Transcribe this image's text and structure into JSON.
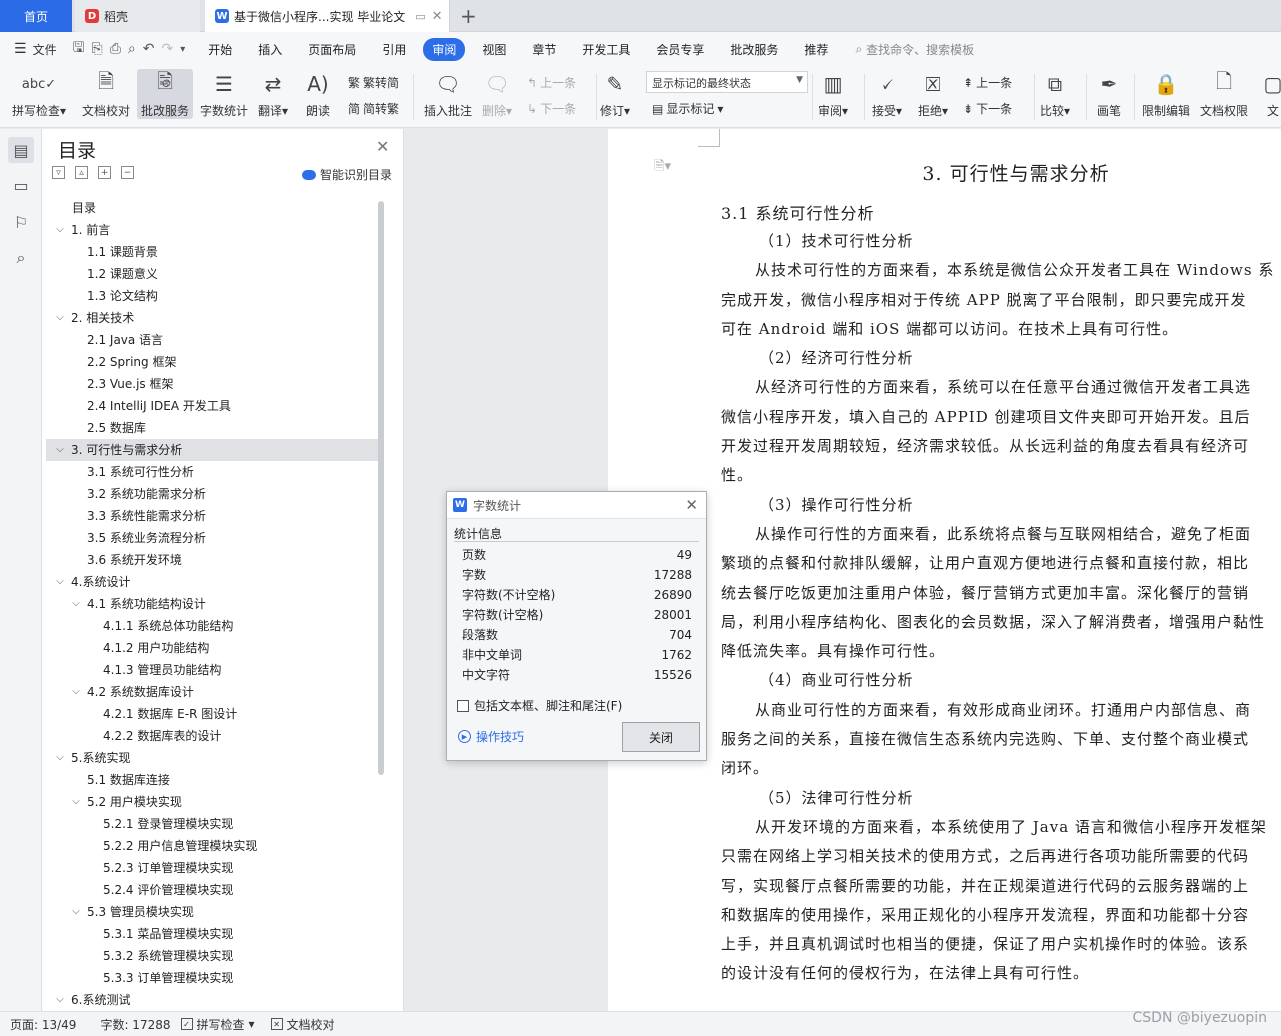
{
  "tabs": {
    "home": "首页",
    "shell": "稻壳",
    "doc": "基于微信小程序...实现 毕业论文"
  },
  "menubar": {
    "file": "文件",
    "items": [
      "开始",
      "插入",
      "页面布局",
      "引用",
      "审阅",
      "视图",
      "章节",
      "开发工具",
      "会员专享",
      "批改服务",
      "推荐"
    ],
    "active": "审阅",
    "search_placeholder": "查找命令、搜索模板"
  },
  "ribbon": {
    "spellcheck": "拼写检查",
    "proofread": "文档校对",
    "correction_service": "批改服务",
    "word_count": "字数统计",
    "translate": "翻译",
    "read_aloud": "朗读",
    "trad": "繁转简",
    "simp": "简转繁",
    "insert_comment": "插入批注",
    "delete": "删除",
    "prev": "上一条",
    "next": "下一条",
    "track": "修订",
    "display_state": "显示标记的最终状态",
    "show_markup": "显示标记",
    "review": "审阅",
    "accept": "接受",
    "reject": "拒绝",
    "prev2": "上一条",
    "next2": "下一条",
    "compare": "比较",
    "pen": "画笔",
    "restrict": "限制编辑",
    "doc_rights": "文档权限",
    "more": "文"
  },
  "toc": {
    "title": "目录",
    "smart": "智能识别目录",
    "items": [
      {
        "text": "目录",
        "level": 0,
        "chev": false
      },
      {
        "text": "1.  前言",
        "level": 0,
        "chev": true
      },
      {
        "text": "1.1  课题背景",
        "level": 1,
        "chev": false
      },
      {
        "text": "1.2  课题意义",
        "level": 1,
        "chev": false
      },
      {
        "text": "1.3  论文结构",
        "level": 1,
        "chev": false
      },
      {
        "text": "2.  相关技术",
        "level": 0,
        "chev": true
      },
      {
        "text": "2.1 Java 语言",
        "level": 1,
        "chev": false
      },
      {
        "text": "2.2 Spring 框架",
        "level": 1,
        "chev": false
      },
      {
        "text": "2.3 Vue.js 框架",
        "level": 1,
        "chev": false
      },
      {
        "text": "2.4 IntelliJ IDEA 开发工具",
        "level": 1,
        "chev": false
      },
      {
        "text": "2.5  数据库",
        "level": 1,
        "chev": false
      },
      {
        "text": "3.  可行性与需求分析",
        "level": 0,
        "chev": true,
        "active": true
      },
      {
        "text": "3.1  系统可行性分析",
        "level": 1,
        "chev": false
      },
      {
        "text": "3.2  系统功能需求分析",
        "level": 1,
        "chev": false
      },
      {
        "text": "3.3  系统性能需求分析",
        "level": 1,
        "chev": false
      },
      {
        "text": "3.5  系统业务流程分析",
        "level": 1,
        "chev": false
      },
      {
        "text": "3.6  系统开发环境",
        "level": 1,
        "chev": false
      },
      {
        "text": "4.系统设计",
        "level": 0,
        "chev": true
      },
      {
        "text": "4.1 系统功能结构设计",
        "level": 1,
        "chev": true
      },
      {
        "text": "4.1.1  系统总体功能结构",
        "level": 2,
        "chev": false
      },
      {
        "text": "4.1.2  用户功能结构",
        "level": 2,
        "chev": false
      },
      {
        "text": "4.1.3  管理员功能结构",
        "level": 2,
        "chev": false
      },
      {
        "text": "4.2  系统数据库设计",
        "level": 1,
        "chev": true
      },
      {
        "text": "4.2.1  数据库 E-R 图设计",
        "level": 2,
        "chev": false
      },
      {
        "text": "4.2.2  数据库表的设计",
        "level": 2,
        "chev": false
      },
      {
        "text": "5.系统实现",
        "level": 0,
        "chev": true
      },
      {
        "text": "5.1 数据库连接",
        "level": 1,
        "chev": false
      },
      {
        "text": "5.2 用户模块实现",
        "level": 1,
        "chev": true
      },
      {
        "text": "5.2.1  登录管理模块实现",
        "level": 2,
        "chev": false
      },
      {
        "text": "5.2.2  用户信息管理模块实现",
        "level": 2,
        "chev": false
      },
      {
        "text": "5.2.3  订单管理模块实现",
        "level": 2,
        "chev": false
      },
      {
        "text": "5.2.4  评价管理模块实现",
        "level": 2,
        "chev": false
      },
      {
        "text": "5.3  管理员模块实现",
        "level": 1,
        "chev": true
      },
      {
        "text": "5.3.1  菜品管理模块实现",
        "level": 2,
        "chev": false
      },
      {
        "text": "5.3.2  系统管理模块实现",
        "level": 2,
        "chev": false
      },
      {
        "text": "5.3.3  订单管理模块实现",
        "level": 2,
        "chev": false
      },
      {
        "text": "6.系统测试",
        "level": 0,
        "chev": true
      }
    ]
  },
  "page": {
    "chapter": "3. 可行性与需求分析",
    "section": "3.1  系统可行性分析",
    "lines": [
      {
        "t": "（1）技术可行性分析",
        "k": "sub"
      },
      {
        "t": "从技术可行性的方面来看，本系统是微信公众开发者工具在 Windows 系",
        "k": "ind"
      },
      {
        "t": "完成开发，微信小程序相对于传统 APP 脱离了平台限制，即只要完成开发",
        "k": ""
      },
      {
        "t": "可在 Android 端和 iOS 端都可以访问。在技术上具有可行性。",
        "k": ""
      },
      {
        "t": "（2）经济可行性分析",
        "k": "sub"
      },
      {
        "t": "从经济可行性的方面来看，系统可以在任意平台通过微信开发者工具选",
        "k": "ind"
      },
      {
        "t": "微信小程序开发，填入自己的 APPID 创建项目文件夹即可开始开发。且后",
        "k": ""
      },
      {
        "t": "开发过程开发周期较短，经济需求较低。从长远利益的角度去看具有经济可",
        "k": ""
      },
      {
        "t": "性。",
        "k": ""
      },
      {
        "t": "（3）操作可行性分析",
        "k": "sub"
      },
      {
        "t": "从操作可行性的方面来看，此系统将点餐与互联网相结合，避免了柜面",
        "k": "ind"
      },
      {
        "t": "繁琐的点餐和付款排队缓解，让用户直观方便地进行点餐和直接付款，相比",
        "k": ""
      },
      {
        "t": "统去餐厅吃饭更加注重用户体验，餐厅营销方式更加丰富。深化餐厅的营销",
        "k": ""
      },
      {
        "t": "局，利用小程序结构化、图表化的会员数据，深入了解消费者，增强用户黏性",
        "k": ""
      },
      {
        "t": "降低流失率。具有操作可行性。",
        "k": ""
      },
      {
        "t": "（4）商业可行性分析",
        "k": "sub"
      },
      {
        "t": "从商业可行性的方面来看，有效形成商业闭环。打通用户内部信息、商",
        "k": "ind"
      },
      {
        "t": "服务之间的关系，直接在微信生态系统内完选购、下单、支付整个商业模式",
        "k": ""
      },
      {
        "t": "闭环。",
        "k": ""
      },
      {
        "t": "（5）法律可行性分析",
        "k": "sub"
      },
      {
        "t": "从开发环境的方面来看，本系统使用了 Java 语言和微信小程序开发框架",
        "k": "ind"
      },
      {
        "t": "只需在网络上学习相关技术的使用方式，之后再进行各项功能所需要的代码",
        "k": ""
      },
      {
        "t": "写，实现餐厅点餐所需要的功能，并在正规渠道进行代码的云服务器端的上",
        "k": ""
      },
      {
        "t": "和数据库的使用操作，采用正规化的小程序开发流程，界面和功能都十分容",
        "k": ""
      },
      {
        "t": "上手，并且真机调试时也相当的便捷，保证了用户实机操作时的体验。该系",
        "k": ""
      },
      {
        "t": "的设计没有任何的侵权行为，在法律上具有可行性。",
        "k": ""
      }
    ]
  },
  "dialog": {
    "title": "字数统计",
    "section": "统计信息",
    "rows": [
      {
        "label": "页数",
        "value": "49"
      },
      {
        "label": "字数",
        "value": "17288"
      },
      {
        "label": "字符数(不计空格)",
        "value": "26890"
      },
      {
        "label": "字符数(计空格)",
        "value": "28001"
      },
      {
        "label": "段落数",
        "value": "704"
      },
      {
        "label": "非中文单词",
        "value": "1762"
      },
      {
        "label": "中文字符",
        "value": "15526"
      }
    ],
    "checkbox": "包括文本框、脚注和尾注(F)",
    "tips": "操作技巧",
    "close": "关闭"
  },
  "status": {
    "page": "页面: 13/49",
    "words": "字数: 17288",
    "spell": "拼写检查",
    "proof": "文档校对"
  },
  "watermark": "CSDN @biyezuopin"
}
